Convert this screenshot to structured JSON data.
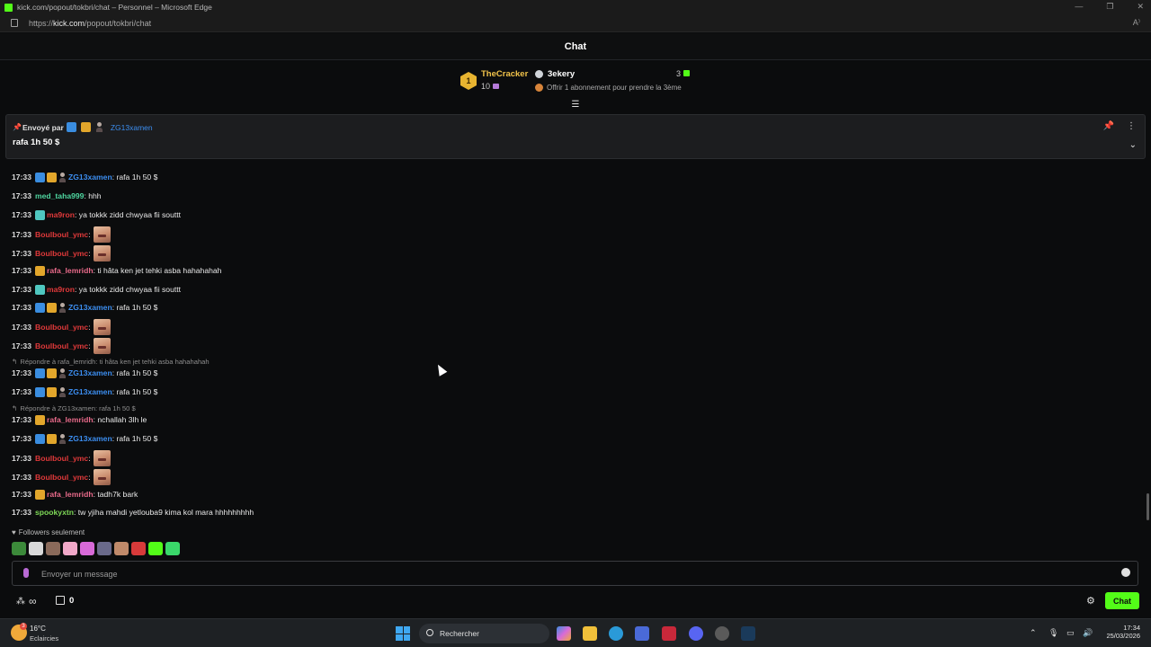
{
  "browser": {
    "window_title": "kick.com/popout/tokbri/chat – Personnel – Microsoft Edge",
    "url_prefix": "https://",
    "url_domain": "kick.com",
    "url_path": "/popout/tokbri/chat"
  },
  "chat": {
    "title": "Chat",
    "leaderboard": {
      "rank": "1",
      "top_name": "TheCracker",
      "top_count": "10",
      "second_name": "3ekery",
      "second_count": "3",
      "offer_text": "Offrir 1 abonnement pour prendre la 3ème"
    },
    "pinned": {
      "sent_by_label": "Envoyé par",
      "user": "ZG13xamen",
      "text": "rafa 1h 50 $"
    },
    "messages": [
      {
        "time": "17:33",
        "user": "ZG13xamen",
        "text": ": rafa 1h 50 $",
        "color": "#3c8ef0"
      },
      {
        "time": "17:33",
        "user": "med_taha999",
        "text": ": hhh",
        "color": "#4fd6a0"
      },
      {
        "time": "17:33",
        "user": "ma9ron",
        "text": ": ya tokkk zidd chwyaa fii souttt",
        "color": "#e0393a"
      },
      {
        "time": "17:33",
        "user": "Boulboul_ymc",
        "text": ":",
        "color": "#e0393a"
      },
      {
        "time": "17:33",
        "user": "Boulboul_ymc",
        "text": ":",
        "color": "#e0393a"
      },
      {
        "time": "17:33",
        "user": "rafa_lemridh",
        "text": ": ti hâta ken jet tehki asba hahahahah",
        "color": "#e86a8a"
      },
      {
        "time": "17:33",
        "user": "ma9ron",
        "text": ": ya tokkk zidd chwyaa fii souttt",
        "color": "#e0393a"
      },
      {
        "time": "17:33",
        "user": "ZG13xamen",
        "text": ": rafa 1h 50 $",
        "color": "#3c8ef0"
      },
      {
        "time": "17:33",
        "user": "Boulboul_ymc",
        "text": ":",
        "color": "#e0393a"
      },
      {
        "time": "17:33",
        "user": "Boulboul_ymc",
        "text": ":",
        "color": "#e0393a"
      },
      {
        "time": "17:33",
        "user": "ZG13xamen",
        "text": ": rafa 1h 50 $",
        "color": "#3c8ef0"
      },
      {
        "time": "17:33",
        "user": "ZG13xamen",
        "text": ": rafa 1h 50 $",
        "color": "#3c8ef0"
      },
      {
        "time": "17:33",
        "user": "rafa_lemridh",
        "text": ": nchallah 3lh le",
        "color": "#e86a8a"
      },
      {
        "time": "17:33",
        "user": "ZG13xamen",
        "text": ": rafa 1h 50 $",
        "color": "#3c8ef0"
      },
      {
        "time": "17:33",
        "user": "Boulboul_ymc",
        "text": ":",
        "color": "#e0393a"
      },
      {
        "time": "17:33",
        "user": "Boulboul_ymc",
        "text": ":",
        "color": "#e0393a"
      },
      {
        "time": "17:33",
        "user": "rafa_lemridh",
        "text": ": tadh7k bark",
        "color": "#e86a8a"
      },
      {
        "time": "17:33",
        "user": "spookyxtn",
        "text": ": tw yjiha mahdi yetlouba9 kima kol mara hhhhhhhhh",
        "color": "#7ed957"
      }
    ],
    "replies": [
      {
        "text": "Répondre à rafa_lemridh: ti hâta ken jet tehki asba hahahahah"
      },
      {
        "text": "Répondre à ZG13xamen: rafa 1h 50 $"
      }
    ],
    "followers_only": "Followers seulement",
    "input_placeholder": "Envoyer un message",
    "points": "0",
    "send_label": "Chat"
  },
  "taskbar": {
    "temperature": "16°C",
    "condition": "Eclaircies",
    "weather_badge": "3",
    "search_label": "Rechercher",
    "time": "17:34",
    "date": "25/03/2026"
  },
  "colors": {
    "kick_green": "#53fc18",
    "background": "#0b0c0d"
  }
}
